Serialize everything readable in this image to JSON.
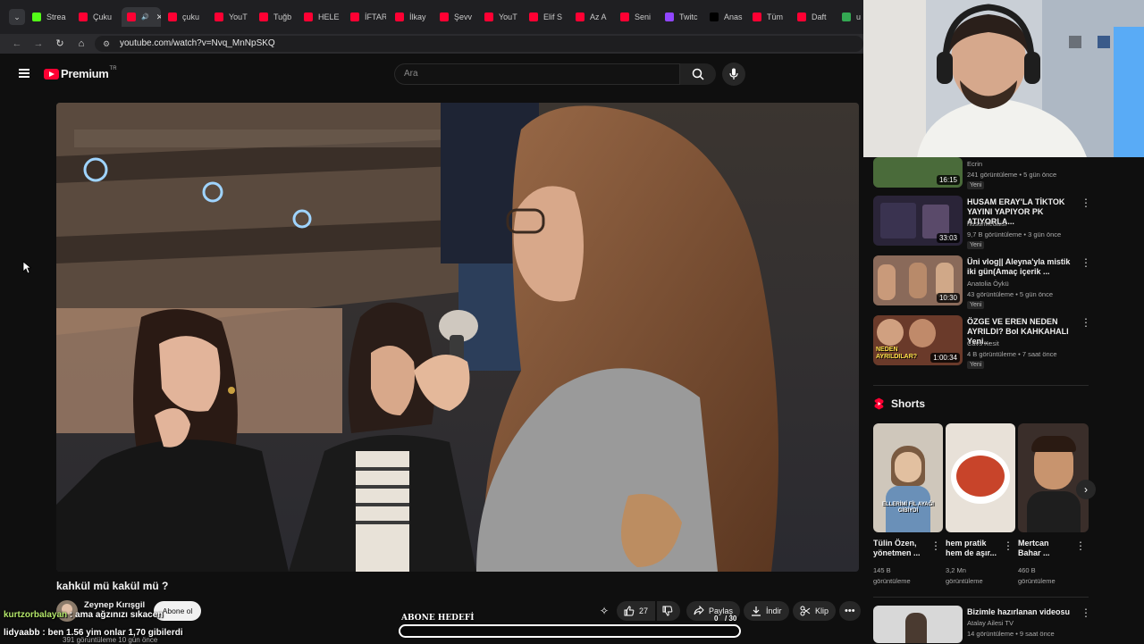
{
  "browser": {
    "tabs": [
      {
        "label": "Strea",
        "color": "#53fc18"
      },
      {
        "label": "Çuku",
        "color": "#ff0033"
      },
      {
        "label": "",
        "color": "#ff0033"
      },
      {
        "label": "çuku",
        "color": "#ff0033"
      },
      {
        "label": "YouT",
        "color": "#ff0033"
      },
      {
        "label": "Tuğb",
        "color": "#ff0033"
      },
      {
        "label": "HELE",
        "color": "#ff0033"
      },
      {
        "label": "İFTAR",
        "color": "#ff0033"
      },
      {
        "label": "İlkay",
        "color": "#ff0033"
      },
      {
        "label": "Şevv",
        "color": "#ff0033"
      },
      {
        "label": "YouT",
        "color": "#ff0033"
      },
      {
        "label": "Elif S",
        "color": "#ff0033"
      },
      {
        "label": "Az A",
        "color": "#ff0033"
      },
      {
        "label": "Seni",
        "color": "#ff0033"
      },
      {
        "label": "Twitc",
        "color": "#9146ff"
      },
      {
        "label": "Anas",
        "color": "#000000"
      },
      {
        "label": "Tüm",
        "color": "#ff0033"
      },
      {
        "label": "Daft",
        "color": "#ff0033"
      },
      {
        "label": "u",
        "color": "#34a853"
      }
    ],
    "url": "youtube.com/watch?v=Nvq_MnNpSKQ"
  },
  "header": {
    "logo_text": "Premium",
    "logo_sup": "TR",
    "search_placeholder": "Ara"
  },
  "video": {
    "title": "kahkül mü kakül mü ?",
    "channel": "Zeynep Kırışgil",
    "subscribe_label": "Abone ol",
    "views_line": "391 görüntüleme  10 gün önce",
    "likes": "27",
    "share_label": "Paylaş",
    "download_label": "İndir",
    "clip_label": "Klip"
  },
  "overlay": {
    "goal_label": "ABONE HEDEFİ",
    "goal_value": "0",
    "goal_sep": "/ 30",
    "goal_progress": 0,
    "chat": [
      {
        "user": "kurtzorbalayan",
        "text": " : ama ağzınızı sıkacen"
      },
      {
        "user": "lidyaabb",
        "text": " : ben 1.56 yim onlar 1,70 gibilerdi"
      }
    ]
  },
  "sidebar": {
    "videos": [
      {
        "title": "",
        "channel": "Ecrin",
        "meta": "241 görüntüleme • 5 gün önce",
        "duration": "16:15",
        "badge": "Yeni",
        "thumb_color": "#4a6b3a"
      },
      {
        "title": "HUSAM ERAY'LA TİKTOK YAYINI YAPIYOR PK ATIYORLA...",
        "channel": "husamfedaisi",
        "meta": "9,7 B görüntüleme • 3 gün önce",
        "duration": "33:03",
        "badge": "Yeni",
        "thumb_color": "#2a2438"
      },
      {
        "title": "Üni vlog|| Aleyna'yla mistik iki gün(Amaç içerik ...",
        "channel": "Anatolia Öykü",
        "meta": "43 görüntüleme • 5 gün önce",
        "duration": "10:30",
        "badge": "Yeni",
        "thumb_color": "#8a6a5a"
      },
      {
        "title": "ÖZGE VE EREN NEDEN AYRILDI? Bol KAHKAHALI Yeni...",
        "channel": "Cavs Kesit",
        "meta": "4 B görüntüleme • 7 saat önce",
        "duration": "1:00:34",
        "badge": "Yeni",
        "thumb_color": "#6a3a2a",
        "thumb_text": "NEDEN AYRILDILAR?"
      }
    ],
    "shorts_title": "Shorts",
    "shorts": [
      {
        "title": "Tülin Özen, yönetmen ...",
        "views": "145 B görüntüleme",
        "thumb_color": "#cfc7bb",
        "thumb_text": "ELLERİMİ FİL AYAĞI GİBİYDİ"
      },
      {
        "title": "hem pratik hem de aşır...",
        "views": "3,2 Mn görüntüleme",
        "thumb_color": "#e8e1d8"
      },
      {
        "title": "Mertcan Bahar ...",
        "views": "460 B görüntüleme",
        "thumb_color": "#3a2e2a"
      }
    ],
    "last_video": {
      "title": "Bizimle hazırlanan videosu",
      "channel": "Atalay Ailesi TV",
      "meta": "14 görüntüleme • 9 saat önce",
      "thumb_color": "#d8d8d8"
    }
  }
}
